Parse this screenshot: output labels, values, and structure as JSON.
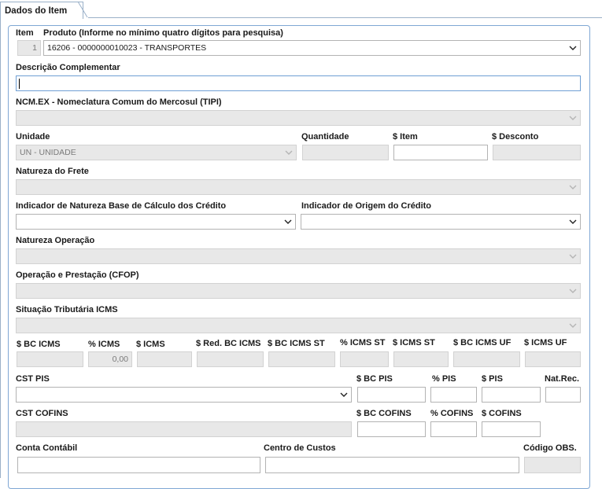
{
  "tab": {
    "label": "Dados do Item"
  },
  "labels": {
    "item": "Item",
    "produto": "Produto (Informe no mínimo quatro dígitos para pesquisa)",
    "descricao": "Descrição Complementar",
    "ncm": "NCM.EX - Nomeclatura Comum do Mercosul (TIPI)",
    "unidade": "Unidade",
    "quantidade": "Quantidade",
    "valor_item": "$ Item",
    "desconto": "$ Desconto",
    "natureza_frete": "Natureza do Frete",
    "ind_natureza_bc": "Indicador de Natureza Base de Cálculo dos Crédito",
    "ind_origem": "Indicador de Origem do Crédito",
    "natureza_operacao": "Natureza Operação",
    "cfop": "Operação e Prestação (CFOP)",
    "sit_icms": "Situação Tributária ICMS",
    "bc_icms": "$ BC ICMS",
    "pct_icms": "% ICMS",
    "icms": "$ ICMS",
    "red_bc_icms": "$ Red. BC ICMS",
    "bc_icms_st": "$ BC ICMS ST",
    "pct_icms_st": "% ICMS ST",
    "icms_st": "$ ICMS ST",
    "bc_icms_uf": "$ BC ICMS UF",
    "icms_uf": "$ ICMS UF",
    "cst_pis": "CST PIS",
    "bc_pis": "$ BC PIS",
    "pct_pis": "% PIS",
    "pis": "$ PIS",
    "nat_rec": "Nat.Rec.",
    "cst_cofins": "CST COFINS",
    "bc_cofins": "$ BC COFINS",
    "pct_cofins": "% COFINS",
    "cofins": "$ COFINS",
    "conta_contabil": "Conta Contábil",
    "centro_custos": "Centro de Custos",
    "codigo_obs": "Código OBS."
  },
  "values": {
    "item": "1",
    "produto": "16206 - 0000000010023 - TRANSPORTES",
    "unidade": "UN - UNIDADE",
    "pct_icms": "0,00"
  }
}
